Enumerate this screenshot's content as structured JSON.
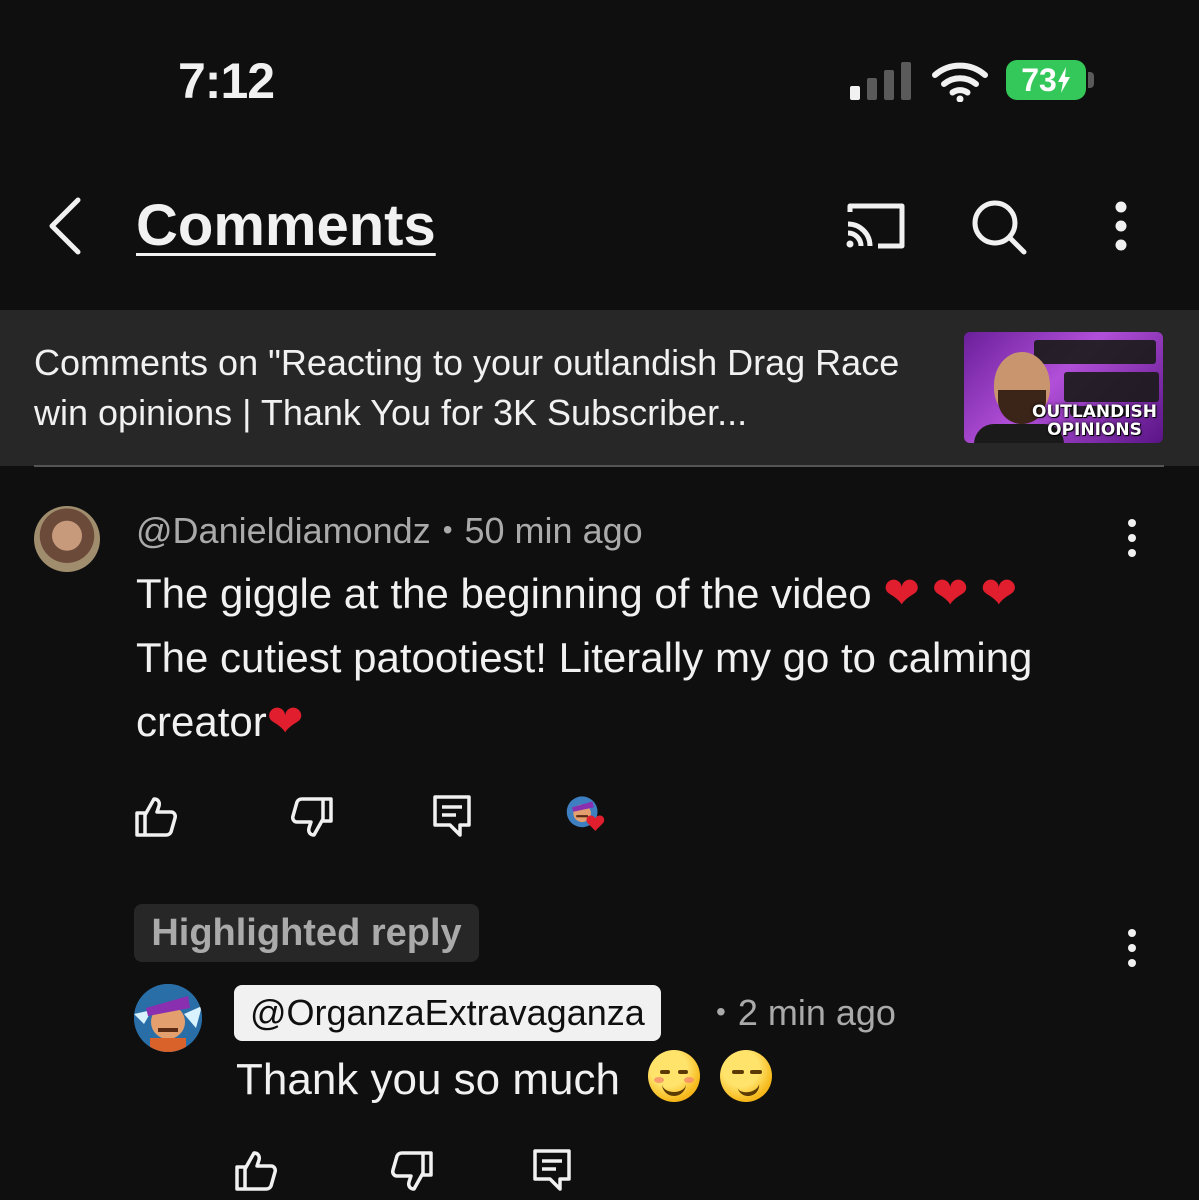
{
  "status_bar": {
    "time": "7:12",
    "battery": "73"
  },
  "header": {
    "title": "Comments"
  },
  "video_context": {
    "text": "Comments on \"Reacting to your outlandish Drag Race win opinions | Thank You for 3K Subscriber...",
    "thumbnail_title_line1": "OUTLANDISH",
    "thumbnail_title_line2": "OPINIONS"
  },
  "comment": {
    "author": "@Danieldiamondz",
    "separator": "•",
    "time": "50 min ago",
    "text_part1": "The giggle at the beginning of the video ",
    "text_part2": " The cutiest patootiest! Literally my go to calming creator",
    "heart": "❤"
  },
  "highlighted_reply": {
    "label": "Highlighted reply",
    "author": "@OrganzaExtravaganza",
    "separator": "•",
    "time": "2 min ago",
    "text": "Thank you so much"
  },
  "colors": {
    "background": "#0f0f0f",
    "surface": "#272727",
    "text_primary": "#f1f1f1",
    "text_secondary": "#aaaaaa",
    "battery": "#34c759",
    "heart": "#e01e2e"
  },
  "icons": [
    "back-icon",
    "cast-icon",
    "search-icon",
    "more-vert-icon",
    "like-icon",
    "dislike-icon",
    "reply-icon",
    "creator-heart-icon"
  ]
}
